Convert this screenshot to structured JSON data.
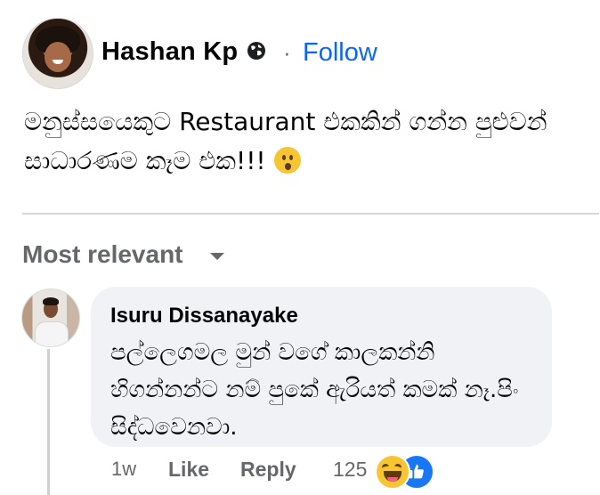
{
  "post": {
    "author": "Hashan Kp",
    "separator": "·",
    "follow_label": "Follow",
    "text_line1": "මනුස්සයෙකුට Restaurant එකකින් ගන්න පුළුවන්",
    "text_line2": "සාධාරණම කෑම එක!!!",
    "emoji": "surprised-emoji"
  },
  "comments_section": {
    "sort_label": "Most relevant"
  },
  "comment": {
    "author": "Isuru Dissanayake",
    "text_line1": "පල්ලෙගමල මුන් වගේ කාලකන්නි",
    "text_line2": "හිගන්නන්ට නම් පුකේ ඇරියත් කමක් නෑ.පිං",
    "text_line3": "සිද්ධවෙනවා.",
    "time": "1w",
    "like_label": "Like",
    "reply_label": "Reply",
    "reaction_count": "125",
    "reactions": [
      "haha-icon",
      "like-icon"
    ]
  },
  "colors": {
    "accent": "#0866ff",
    "secondary_text": "#65676b",
    "bubble_bg": "#f0f2f5",
    "like_blue": "#1877f2"
  }
}
